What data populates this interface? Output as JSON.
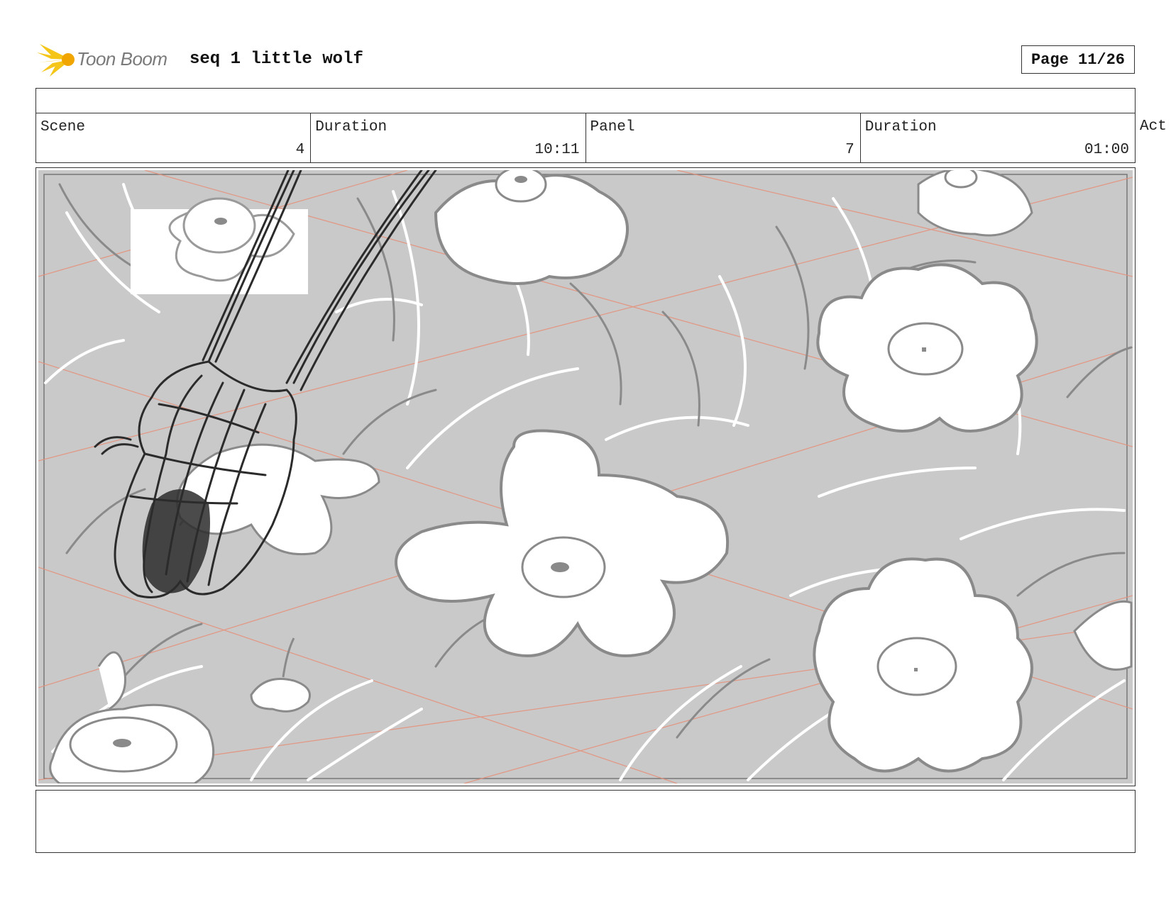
{
  "header": {
    "logo_text": "Toon Boom",
    "title": "seq 1 little wolf",
    "page": "Page 11/26"
  },
  "info": {
    "scene_label": "Scene",
    "scene_value": "4",
    "scene_duration_label": "Duration",
    "scene_duration_value": "10:11",
    "panel_label": "Panel",
    "panel_value": "7",
    "panel_duration_label": "Duration",
    "panel_duration_value": "01:00",
    "act_label": "Act"
  },
  "colors": {
    "logo_accent": "#f5c518",
    "sketch_background": "#c9c9c9",
    "perspective_lines": "#e6907a",
    "ink": "#2b2b2b"
  }
}
